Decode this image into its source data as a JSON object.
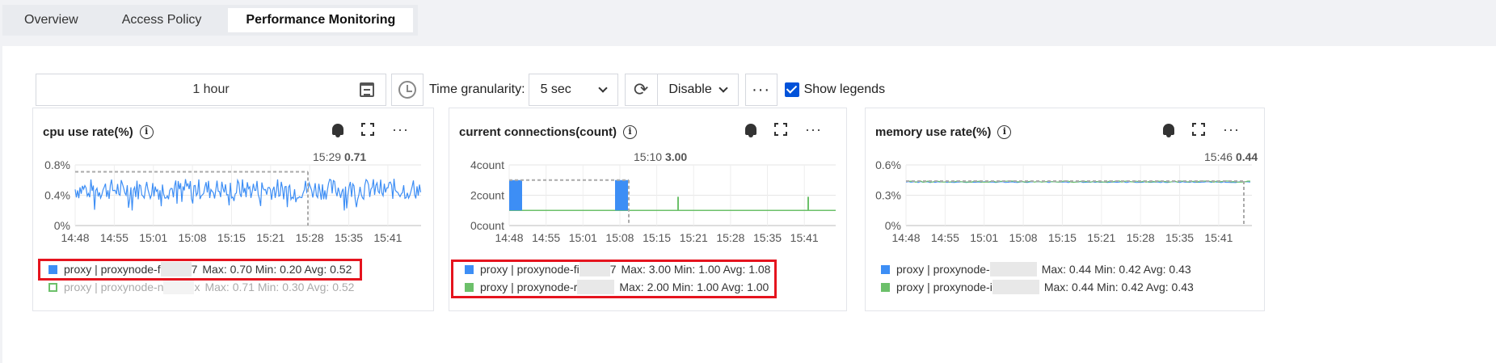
{
  "tabs": [
    "Overview",
    "Access Policy",
    "Performance Monitoring"
  ],
  "toolbar": {
    "time_range": "1 hour",
    "granularity_label": "Time granularity:",
    "granularity_value": "5 sec",
    "refresh_value": "Disable",
    "show_legends_label": "Show legends",
    "more": "···"
  },
  "cards": [
    {
      "title": "cpu use rate(%)",
      "tooltip_time": "15:29",
      "tooltip_value": "0.71",
      "legend": [
        {
          "name_a": "proxy | proxynode-f",
          "name_b": "7",
          "stats": "Max: 0.70  Min: 0.20  Avg: 0.52"
        },
        {
          "name_a": "proxy | proxynode-n",
          "name_b": "x",
          "stats": "Max: 0.71  Min: 0.30  Avg: 0.52"
        }
      ]
    },
    {
      "title": "current connections(count)",
      "tooltip_time": "15:10",
      "tooltip_value": "3.00",
      "legend": [
        {
          "name_a": "proxy | proxynode-fi",
          "name_b": "7",
          "stats": "Max: 3.00  Min: 1.00  Avg: 1.08"
        },
        {
          "name_a": "proxy | proxynode-r",
          "name_b": "",
          "stats": "Max: 2.00  Min: 1.00  Avg: 1.00"
        }
      ]
    },
    {
      "title": "memory use rate(%)",
      "tooltip_time": "15:46",
      "tooltip_value": "0.44",
      "legend": [
        {
          "name_a": "proxy | proxynode-",
          "name_b": "",
          "stats": "Max: 0.44  Min: 0.42  Avg: 0.43"
        },
        {
          "name_a": "proxy | proxynode-i",
          "name_b": "",
          "stats": "Max: 0.44  Min: 0.42  Avg: 0.43"
        }
      ]
    }
  ],
  "chart_data": [
    {
      "type": "line",
      "title": "cpu use rate(%)",
      "x_ticks": [
        "14:48",
        "14:55",
        "15:01",
        "15:08",
        "15:15",
        "15:21",
        "15:28",
        "15:35",
        "15:41"
      ],
      "y_ticks": [
        "0%",
        "0.4%",
        "0.8%"
      ],
      "ylim": [
        0,
        0.8
      ],
      "series": [
        {
          "name": "proxy | proxynode-f…7",
          "color": "#3d8ef5",
          "values_summary": {
            "max": 0.7,
            "min": 0.2,
            "avg": 0.52
          }
        },
        {
          "name": "proxy | proxynode-n…x",
          "color": "#6cc06a",
          "hidden": true,
          "values_summary": {
            "max": 0.71,
            "min": 0.3,
            "avg": 0.52
          }
        }
      ],
      "marker": {
        "x": "15:29",
        "y": 0.71
      }
    },
    {
      "type": "line",
      "title": "current connections(count)",
      "x_ticks": [
        "14:48",
        "14:55",
        "15:01",
        "15:08",
        "15:15",
        "15:21",
        "15:28",
        "15:35",
        "15:41"
      ],
      "y_ticks": [
        "0count",
        "2count",
        "4count"
      ],
      "ylim": [
        0,
        4
      ],
      "series": [
        {
          "name": "proxy | proxynode-fi…7",
          "color": "#3d8ef5",
          "values_summary": {
            "max": 3.0,
            "min": 1.0,
            "avg": 1.08
          }
        },
        {
          "name": "proxy | proxynode-r…",
          "color": "#6cc06a",
          "values_summary": {
            "max": 2.0,
            "min": 1.0,
            "avg": 1.0
          }
        }
      ],
      "marker": {
        "x": "15:10",
        "y": 3.0
      }
    },
    {
      "type": "line",
      "title": "memory use rate(%)",
      "x_ticks": [
        "14:48",
        "14:55",
        "15:01",
        "15:08",
        "15:15",
        "15:21",
        "15:28",
        "15:35",
        "15:41"
      ],
      "y_ticks": [
        "0%",
        "0.3%",
        "0.6%"
      ],
      "ylim": [
        0,
        0.6
      ],
      "series": [
        {
          "name": "proxy | proxynode-…",
          "color": "#3d8ef5",
          "values_summary": {
            "max": 0.44,
            "min": 0.42,
            "avg": 0.43
          }
        },
        {
          "name": "proxy | proxynode-i…",
          "color": "#6cc06a",
          "values_summary": {
            "max": 0.44,
            "min": 0.42,
            "avg": 0.43
          }
        }
      ],
      "marker": {
        "x": "15:46",
        "y": 0.44
      }
    }
  ]
}
